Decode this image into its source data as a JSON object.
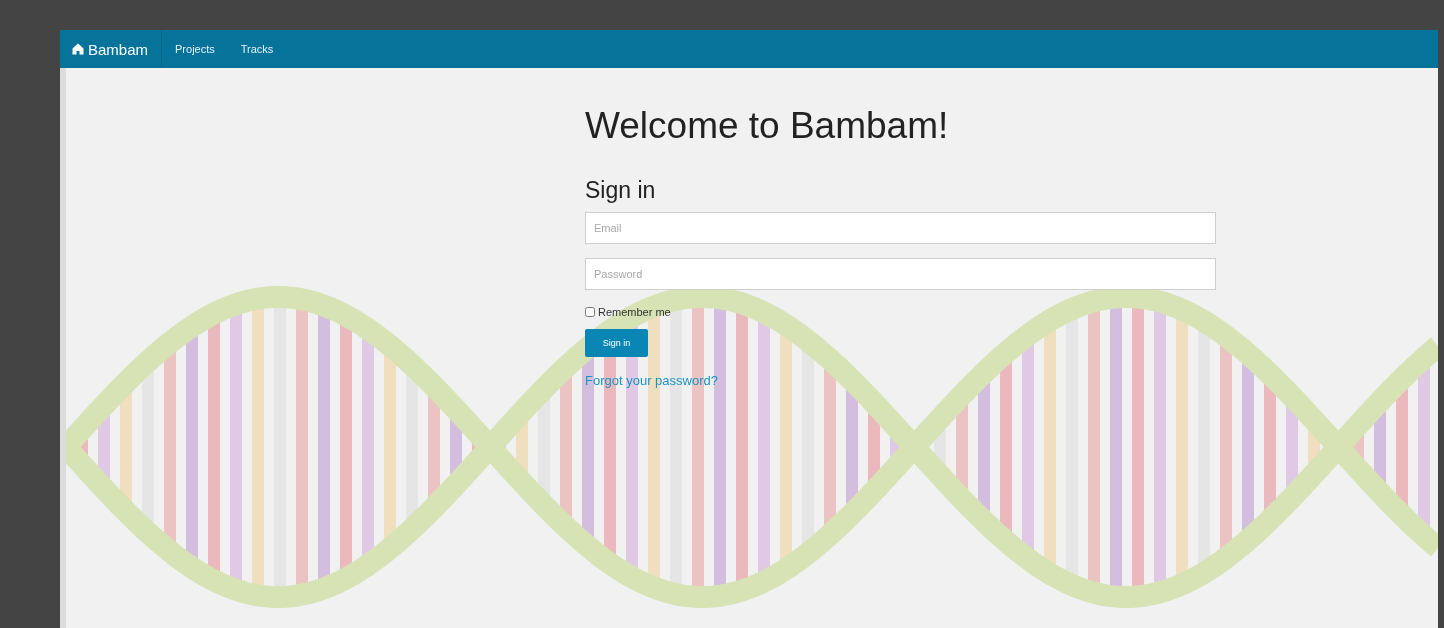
{
  "navbar": {
    "brand": "Bambam",
    "links": [
      {
        "label": "Projects"
      },
      {
        "label": "Tracks"
      }
    ]
  },
  "heading": "Welcome to Bambam!",
  "sign_in": {
    "title": "Sign in",
    "fields": [
      {
        "placeholder": "Email"
      },
      {
        "placeholder": "Password"
      }
    ],
    "remember_me": {
      "label": "Remember me",
      "checked": false
    },
    "button": "Sign in",
    "forgot_link": "Forgot your password?"
  }
}
